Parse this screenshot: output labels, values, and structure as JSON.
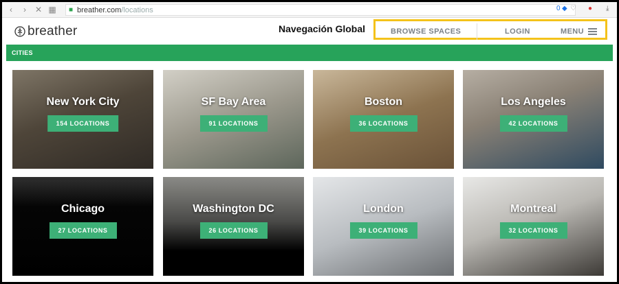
{
  "browser": {
    "url_domain": "breather.com",
    "url_path": "/locations",
    "badge_count": "0"
  },
  "header": {
    "logo_text": "breather",
    "annotation": "Navegación Global",
    "nav": {
      "browse": "BROWSE SPACES",
      "login": "LOGIN",
      "menu": "MENU"
    },
    "annotation_box_color": "#f4c21a"
  },
  "cities_bar": {
    "label": "CITIES",
    "color": "#27a35a"
  },
  "cities": [
    {
      "name": "New York City",
      "locations": "154 LOCATIONS"
    },
    {
      "name": "SF Bay Area",
      "locations": "91 LOCATIONS"
    },
    {
      "name": "Boston",
      "locations": "36 LOCATIONS"
    },
    {
      "name": "Los Angeles",
      "locations": "42 LOCATIONS"
    },
    {
      "name": "Chicago",
      "locations": "27 LOCATIONS"
    },
    {
      "name": "Washington DC",
      "locations": "26 LOCATIONS"
    },
    {
      "name": "London",
      "locations": "39 LOCATIONS"
    },
    {
      "name": "Montreal",
      "locations": "32 LOCATIONS"
    }
  ],
  "accent_button_color": "#3db077"
}
